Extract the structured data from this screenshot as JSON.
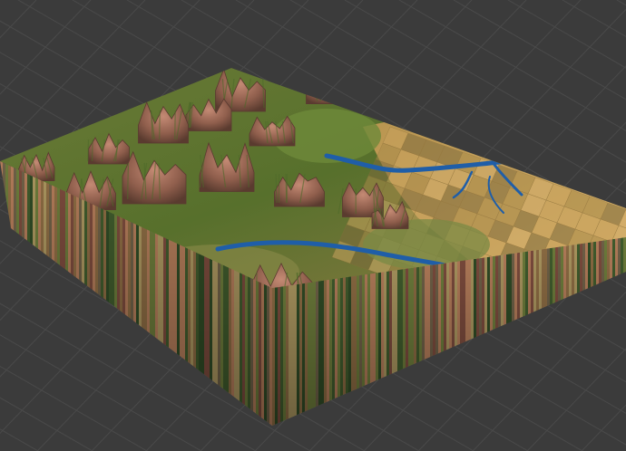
{
  "viewport": {
    "background": "#3b3b3b",
    "grid_color": "#4a4a4a"
  },
  "terrain": {
    "shading": "vertex-color",
    "side_strata": [
      "#6b7a3a",
      "#8a6a42",
      "#3f5a2c",
      "#b07a58",
      "#6d5f46",
      "#a8945e",
      "#2f4a25",
      "#7a4a3c"
    ],
    "colors": {
      "mountain_peak": "#b07a66",
      "mountain_shadow": "#5a3a30",
      "valley_green": "#4e6a2a",
      "meadow": "#6f7d35",
      "farmland_light": "#c9a35e",
      "farmland_dark": "#7d6a3c",
      "river": "#1f5ea8"
    }
  }
}
